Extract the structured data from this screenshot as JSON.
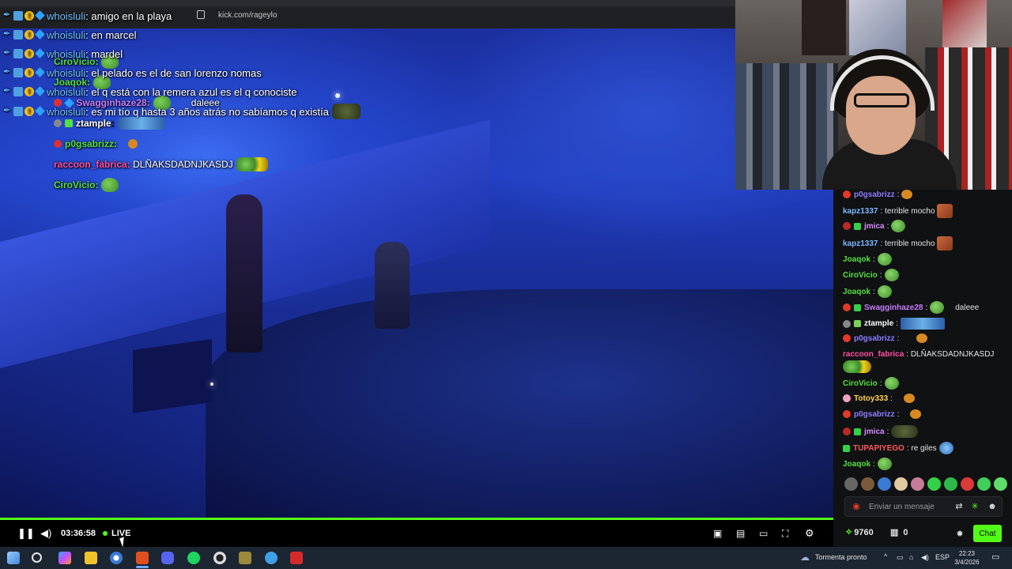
{
  "browser": {
    "url": "kick.com/rageylo"
  },
  "overlay_chat": [
    {
      "user": "whoisluli",
      "message": "amigo en la playa"
    },
    {
      "user": "whoisluli",
      "message": "en marcel"
    },
    {
      "user": "whoisluli",
      "message": "mardel"
    },
    {
      "user": "whoisluli",
      "message": "el pelado es el de san lorenzo nomas"
    },
    {
      "user": "whoisluli",
      "message": "el q está con la remera azul es el q conociste"
    },
    {
      "user": "whoisluli",
      "message": "es mi tío q hasta 3 años atrás no sabíamos q existía"
    }
  ],
  "overlay_secondary": [
    {
      "user": "CiroVicio",
      "message": "",
      "color": "#55e040"
    },
    {
      "user": "Joaqok",
      "message": "",
      "color": "#55e040"
    },
    {
      "user": "Swagginhaze28",
      "message": "daleee",
      "color": "#c77dff"
    },
    {
      "user": "ztample",
      "message": "",
      "color": "#ffffff"
    },
    {
      "user": "p0gsabrizz",
      "message": "",
      "color": "#55e040"
    },
    {
      "user": "raccoon_fabrica",
      "message": "DLÑAKSDADNJKASDJ",
      "color": "#ff4fa3"
    },
    {
      "user": "CiroVicio",
      "message": "",
      "color": "#55e040"
    }
  ],
  "chat": {
    "messages": [
      {
        "user": "p0gsabrizz",
        "message": "",
        "color": "#8c7dff"
      },
      {
        "user": "kapz1337",
        "message": "terrible mocho",
        "color": "#7ab8ff"
      },
      {
        "user": "jmica",
        "message": "",
        "color": "#d78bff"
      },
      {
        "user": "kapz1337",
        "message": "terrible mocho",
        "color": "#7ab8ff"
      },
      {
        "user": "Joaqok",
        "message": "",
        "color": "#55e040"
      },
      {
        "user": "CiroVicio",
        "message": "",
        "color": "#55e040"
      },
      {
        "user": "Joaqok",
        "message": "",
        "color": "#55e040"
      },
      {
        "user": "Swagginhaze28",
        "message": "daleee",
        "color": "#c77dff"
      },
      {
        "user": "ztample",
        "message": "",
        "color": "#ffffff"
      },
      {
        "user": "p0gsabrizz",
        "message": "",
        "color": "#8c7dff"
      },
      {
        "user": "raccoon_fabrica",
        "message": "DLÑAKSDADNJKASDJ",
        "color": "#ff4fa3"
      },
      {
        "user": "CiroVicio",
        "message": "",
        "color": "#55e040"
      },
      {
        "user": "Totoy333",
        "message": "",
        "color": "#ffd24f"
      },
      {
        "user": "p0gsabrizz",
        "message": "",
        "color": "#8c7dff"
      },
      {
        "user": "jmica",
        "message": "",
        "color": "#d78bff"
      },
      {
        "user": "TUPAPIYEGO",
        "message": "re giles",
        "color": "#ff5a5a"
      },
      {
        "user": "Joaqok",
        "message": "",
        "color": "#55e040"
      }
    ],
    "input_placeholder": "Enviar un mensaje",
    "points": "9760",
    "gift_count": "0",
    "chat_button": "Chat"
  },
  "player": {
    "time": "03:36:58",
    "live_label": "LIVE",
    "progress": 1.0
  },
  "taskbar": {
    "weather": "Tormenta pronto",
    "lang": "ESP",
    "time": "22:23",
    "date": "3/4/2026"
  },
  "colors": {
    "accent": "#53fc18",
    "chat_bg": "#101113",
    "taskbar": "#1c2532"
  }
}
